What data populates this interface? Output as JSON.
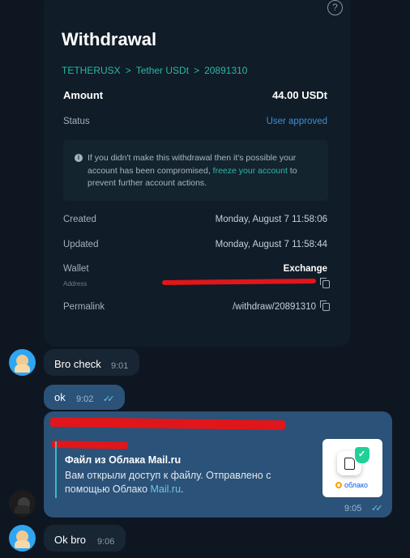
{
  "withdrawal": {
    "title": "Withdrawal",
    "breadcrumb": [
      "TETHERUSX",
      "Tether USDt",
      "20891310"
    ],
    "breadcrumb_separator": ">",
    "amount_label": "Amount",
    "amount_value": "44.00 USDt",
    "status_label": "Status",
    "status_value": "User approved",
    "notice_icon": "info-icon",
    "notice_pre": "If you didn't make this withdrawal then it's possible your account has been compromised, ",
    "notice_link": "freeze your account",
    "notice_post": " to prevent further account actions.",
    "created_label": "Created",
    "created_value": "Monday, August 7 11:58:06",
    "updated_label": "Updated",
    "updated_value": "Monday, August 7 11:58:44",
    "wallet_label": "Wallet",
    "wallet_value": "Exchange",
    "address_label": "Address",
    "permalink_label": "Permalink",
    "permalink_value": "/withdraw/20891310",
    "help_glyph": "?"
  },
  "messages": [
    {
      "text": "Bro check",
      "time": "9:01",
      "direction": "in"
    },
    {
      "text": "ok",
      "time": "9:02",
      "direction": "out",
      "ticks": "✓✓"
    },
    {
      "time": "9:05",
      "direction": "out",
      "ticks": "✓✓"
    },
    {
      "text": "Ok bro",
      "time": "9:06",
      "direction": "in"
    }
  ],
  "link_preview": {
    "title": "Файл из Облака Mail.ru",
    "desc_pre": "Вам открыли доступ к файлу. Отправлено с помощью Облако ",
    "desc_link": "Mail.ru",
    "desc_post": ".",
    "brand": "облако"
  },
  "colors": {
    "accent_teal": "#2bb8a6",
    "status_blue": "#3a8fd6",
    "redaction": "#e0161b",
    "chat_bg": "#0e1621",
    "bubble_in": "#182533",
    "bubble_out": "#2b5278"
  }
}
